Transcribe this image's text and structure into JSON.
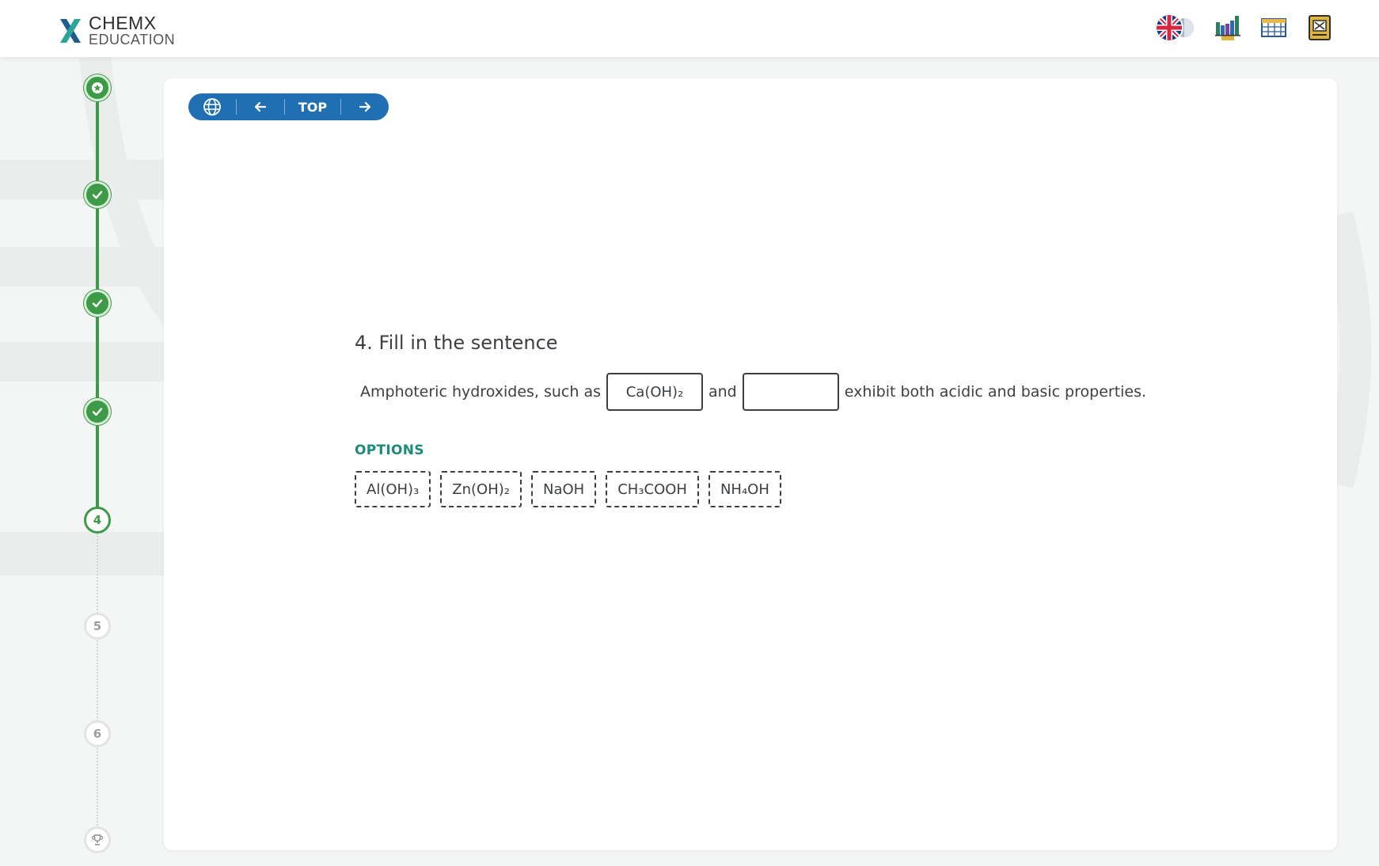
{
  "header": {
    "logo_name": "CHEMX",
    "logo_sub": "EDUCATION",
    "icons": [
      "uk-flag-language-icon",
      "bar-chart-icon",
      "table-icon",
      "book-icon"
    ]
  },
  "stepper": {
    "steps": [
      {
        "label": "",
        "state": "start",
        "icon": "star-icon"
      },
      {
        "label": "",
        "state": "done",
        "icon": "check-icon"
      },
      {
        "label": "",
        "state": "done",
        "icon": "check-icon"
      },
      {
        "label": "",
        "state": "done",
        "icon": "check-icon"
      },
      {
        "label": "4",
        "state": "current"
      },
      {
        "label": "5",
        "state": "future"
      },
      {
        "label": "6",
        "state": "future"
      },
      {
        "label": "",
        "state": "future",
        "icon": "trophy-icon"
      }
    ]
  },
  "nav": {
    "top_label": "TOP"
  },
  "question": {
    "title": "4. Fill in the sentence",
    "prefix": "Amphoteric hydroxides, such as",
    "blank1": "Ca(OH)₂",
    "middle": "and",
    "blank2": "",
    "suffix": "exhibit both acidic and basic properties."
  },
  "options": {
    "label": "OPTIONS",
    "items": [
      "Al(OH)₃",
      "Zn(OH)₂",
      "NaOH",
      "CH₃COOH",
      "NH₄OH"
    ]
  },
  "colors": {
    "accent_green": "#3d9a47",
    "nav_blue": "#1f6fb2",
    "options_teal": "#1e8a7a"
  }
}
